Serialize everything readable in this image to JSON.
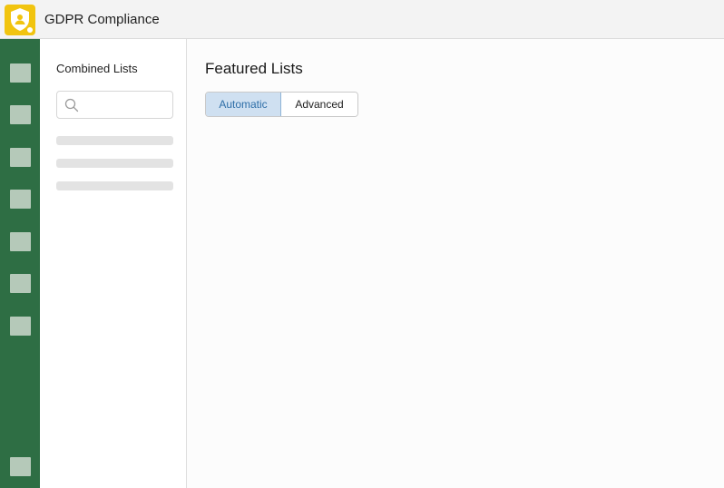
{
  "app": {
    "title": "GDPR Compliance",
    "logo_icon": "shield-user-icon",
    "accent_color": "#f1c40f"
  },
  "rail": {
    "color": "#2e6e44",
    "items": [
      "nav-item-1",
      "nav-item-2",
      "nav-item-3",
      "nav-item-4",
      "nav-item-5",
      "nav-item-6",
      "nav-item-7",
      "nav-item-bottom"
    ]
  },
  "sidebar": {
    "title": "Combined Lists",
    "search": {
      "placeholder": "",
      "icon": "search-icon"
    }
  },
  "main": {
    "title": "Featured Lists",
    "tabs": [
      {
        "label": "Automatic",
        "active": true
      },
      {
        "label": "Advanced",
        "active": false
      }
    ]
  }
}
